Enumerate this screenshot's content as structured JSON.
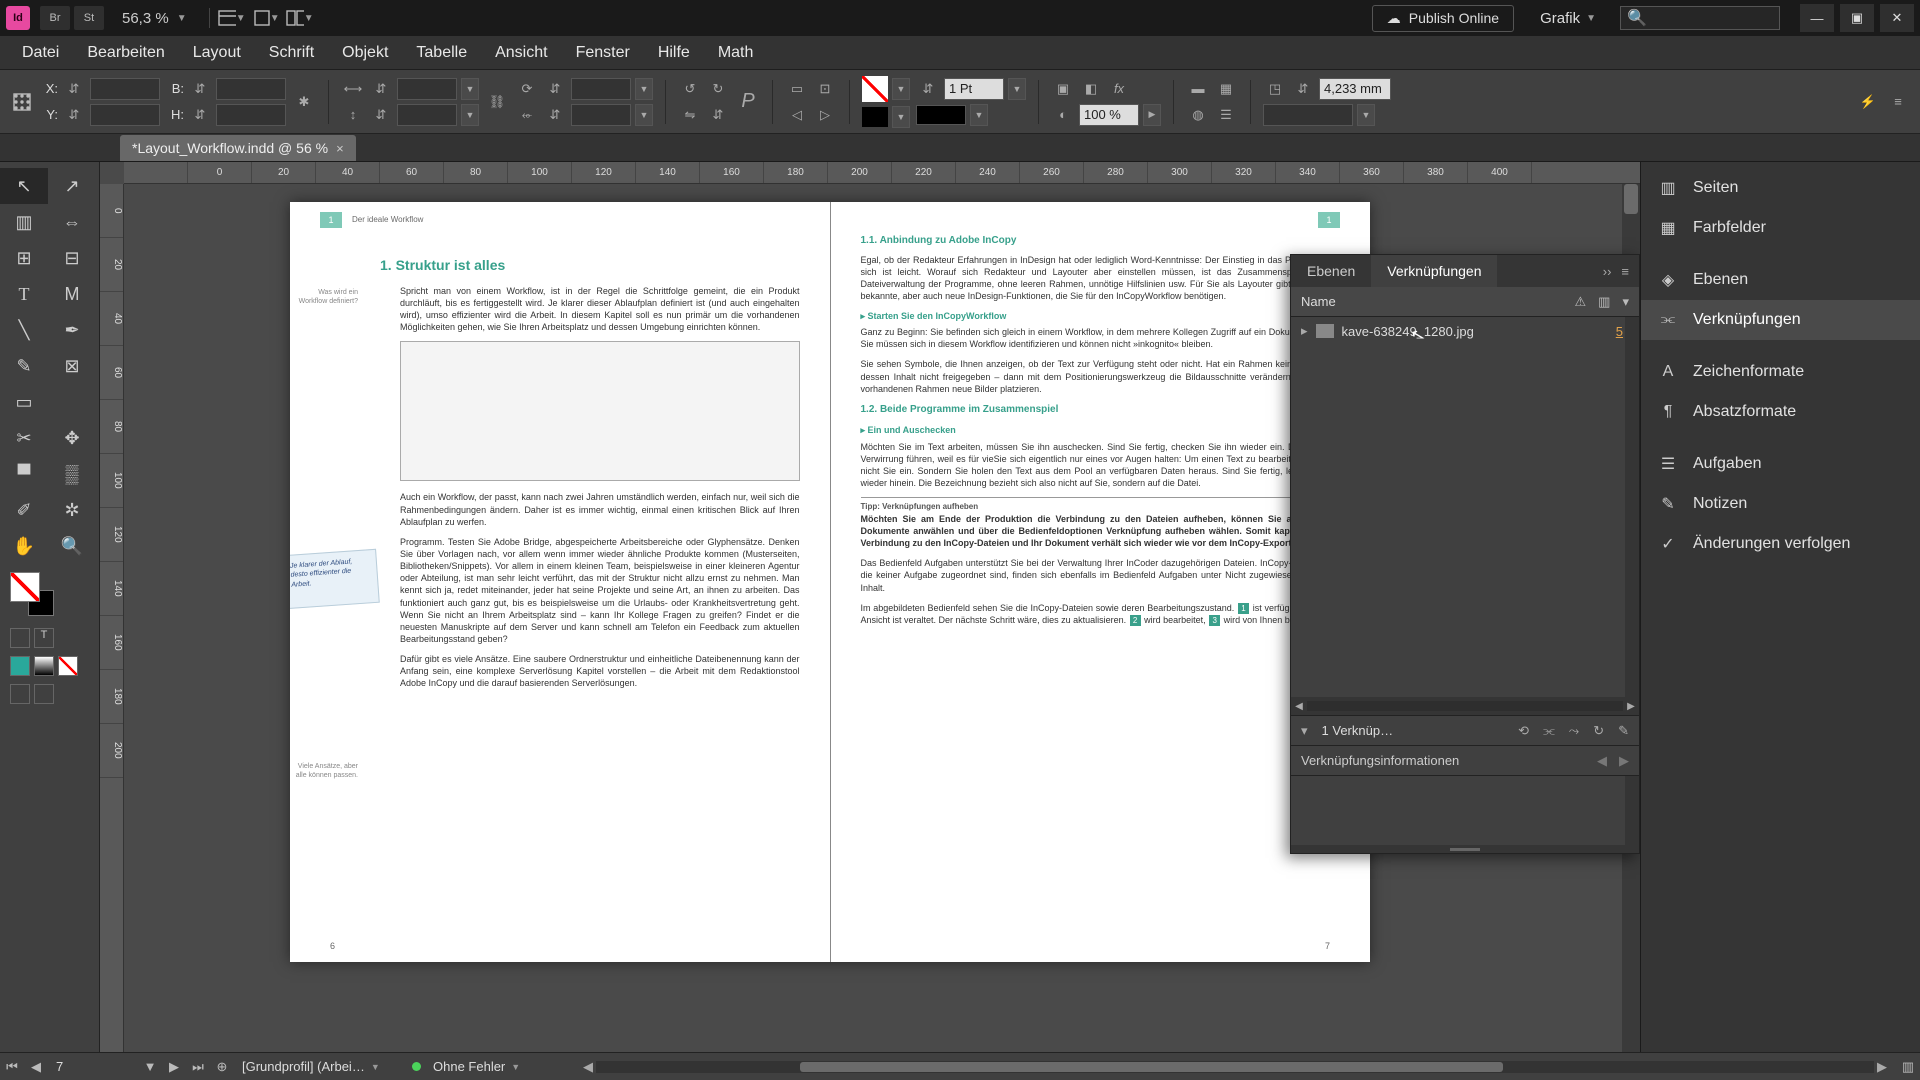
{
  "app": {
    "badge": "Id",
    "br": "Br",
    "st": "St",
    "zoom": "56,3 %"
  },
  "publish": "Publish Online",
  "workspace": "Grafik",
  "menu": [
    "Datei",
    "Bearbeiten",
    "Layout",
    "Schrift",
    "Objekt",
    "Tabelle",
    "Ansicht",
    "Fenster",
    "Hilfe",
    "Math"
  ],
  "control": {
    "x": "X:",
    "y": "Y:",
    "w": "B:",
    "h": "H:",
    "stroke_weight": "1 Pt",
    "opacity": "100 %",
    "corner": "4,233 mm"
  },
  "doc_tab": {
    "title": "*Layout_Workflow.indd @ 56 %"
  },
  "ruler_h": [
    "",
    "0",
    "20",
    "40",
    "60",
    "80",
    "100",
    "120",
    "140",
    "160",
    "180",
    "200",
    "220",
    "240",
    "260",
    "280",
    "300",
    "320",
    "340",
    "360",
    "380",
    "400"
  ],
  "ruler_v": [
    "0",
    "20",
    "40",
    "60",
    "80",
    "100",
    "120",
    "140",
    "160",
    "180",
    "200"
  ],
  "pageL": {
    "run_num": "1",
    "run_txt": "Der ideale Workflow",
    "h1": "1.  Struktur ist alles",
    "sn1": "Was wird ein Workflow definiert?",
    "p1": "Spricht man von einem Workflow, ist in der Regel die Schrittfolge gemeint, die ein Produkt durchläuft, bis es fertiggestellt wird. Je klarer dieser Ablaufplan definiert ist (und auch eingehalten wird), umso effizienter wird die Arbeit. In diesem Kapitel soll es nun primär um die vorhandenen Möglichkeiten gehen, wie Sie Ihren Arbeitsplatz und dessen Umgebung einrichten können.",
    "sticky": "Je klarer der Ablauf, desto effizienter die Arbeit.",
    "p2": "Auch ein Workflow, der passt, kann nach zwei Jahren umständlich werden, einfach nur, weil sich die Rahmenbedingungen ändern. Daher ist es immer wichtig, einmal einen kritischen Blick auf Ihren Ablaufplan zu werfen.",
    "p3": "Programm. Testen Sie Adobe Bridge, abgespeicherte Arbeitsbereiche oder Glyphensätze. Denken Sie über Vorlagen nach, vor allem wenn immer wieder ähnliche Produkte kommen (Musterseiten, Bibliotheken/Snippets). Vor allem in einem kleinen Team, beispielsweise in einer kleineren Agentur oder Abteilung, ist man sehr leicht verführt, das mit der Struktur nicht allzu ernst zu nehmen. Man kennt sich ja, redet miteinander, jeder hat seine Projekte und seine Art, an ihnen zu arbeiten. Das funktioniert auch ganz gut, bis es beispielsweise um die Urlaubs- oder Krankheitsvertretung geht. Wenn Sie nicht an Ihrem Arbeitsplatz sind – kann Ihr Kollege Fragen zu greifen? Findet er die neuesten Manuskripte auf dem Server und kann schnell am Telefon ein Feedback zum aktuellen Bearbeitungsstand geben?",
    "sn2": "Viele Ansätze, aber alle können passen.",
    "p4": "Dafür gibt es viele Ansätze. Eine saubere Ordnerstruktur und einheitliche Dateibenennung kann der Anfang sein, eine komplexe Serverlösung Kapitel vorstellen – die Arbeit mit dem Redaktionstool Adobe InCopy und die darauf basierenden Serverlösungen.",
    "pgnum": "6"
  },
  "pageR": {
    "h2": "1.1.  Anbindung zu Adobe InCopy",
    "p1": "Egal, ob der Redakteur Erfahrungen in InDesign hat oder lediglich Word-Kenntnisse: Der Einstieg in das Programm an sich ist leicht. Worauf sich Redakteur und Layouter aber einstellen müssen, ist das Zusammenspiel und die Dateiverwaltung der Programme, ohne leeren Rahmen, unnötige Hilfslinien usw. Für Sie als Layouter gibt es ein paar bekannte, aber auch neue InDesign-Funktionen, die Sie für den InCopyWorkflow benötigen.",
    "h3a": "▸  Starten Sie den InCopyWorkflow",
    "p2": "Ganz zu Beginn: Sie befinden sich gleich in einem Workflow, in dem mehrere Kollegen Zugriff auf ein Dokument haben. Sie müssen sich in diesem Workflow identifizieren und können nicht »inkognito« bleiben.",
    "p3": "Sie sehen Symbole, die Ihnen anzeigen, ob der Text zur Verfügung steht oder nicht. Hat ein Rahmen kein Symbol, ist dessen Inhalt nicht freigegeben – dann mit dem Positionierungswerkzeug die Bildausschnitte verändern und in den vorhandenen Rahmen neue Bilder platzieren.",
    "h2b": "1.2.  Beide Programme im Zusammenspiel",
    "h3b": "▸  Ein und Auschecken",
    "p4": "Möchten Sie im Text arbeiten, müssen Sie ihn auschecken. Sind Sie fertig, checken Sie ihn wieder ein. Das kann zu Verwirrung führen, weil es für vieSie sich eigentlich nur eines vor Augen halten: Um einen Text zu bearbeiten, checken nicht Sie ein. Sondern Sie holen den Text aus dem Pool an verfügbaren Daten heraus. Sind Sie fertig, legen Sie ihn wieder hinein. Die Bezeichnung bezieht sich also nicht auf Sie, sondern auf die Datei.",
    "tiplab": "Tipp: Verknüpfungen aufheben",
    "tip": "Möchten Sie am Ende der Produktion die Verbindung zu den Dateien aufheben, können Sie alle InCopy-Dokumente anwählen und über die Bedienfeldoptionen Verknüpfung aufheben wählen. Somit kappen Sie die Verbindung zu den InCopy-Dateien und Ihr Dokument verhält sich wieder wie vor dem InCopy-Export.",
    "p5a": "Das Bedienfeld Aufgaben unterstützt Sie bei der Verwaltung Ihrer InCoder dazugehörigen Dateien. InCopy-Dokumente, die keiner Aufgabe zugeordnet sind, finden sich ebenfalls im Bedienfeld Aufgaben unter Nicht zugewiesener InCopy-Inhalt.",
    "p5b": "Im abgebildeten Bedienfeld sehen Sie die InCopy-Dateien sowie deren Bearbeitungszustand. ",
    "b1": "1",
    "p5c": " ist verfügbar, aber die Ansicht ist veraltet. Der nächste Schritt wäre, dies zu aktualisieren. ",
    "b2": "2",
    "p5d": " wird bearbeitet, ",
    "b3": "3",
    "p5e": " wird von Ihnen bearbeitet.",
    "pgnum": "7"
  },
  "flyout": {
    "tab_layers": "Ebenen",
    "tab_links": "Verknüpfungen",
    "col_name": "Name",
    "item_name": "kave-638249_1280.jpg",
    "item_count": "5",
    "summary": "1 Verknüp…",
    "info": "Verknüpfungsinformationen"
  },
  "dock": {
    "g1": [
      "Seiten",
      "Farbfelder"
    ],
    "g2": [
      "Ebenen",
      "Verknüpfungen"
    ],
    "g3": [
      "Zeichenformate",
      "Absatzformate"
    ],
    "g4": [
      "Aufgaben",
      "Notizen",
      "Änderungen verfolgen"
    ]
  },
  "status": {
    "page": "7",
    "profile": "[Grundprofil] (Arbei…",
    "errors": "Ohne Fehler"
  }
}
